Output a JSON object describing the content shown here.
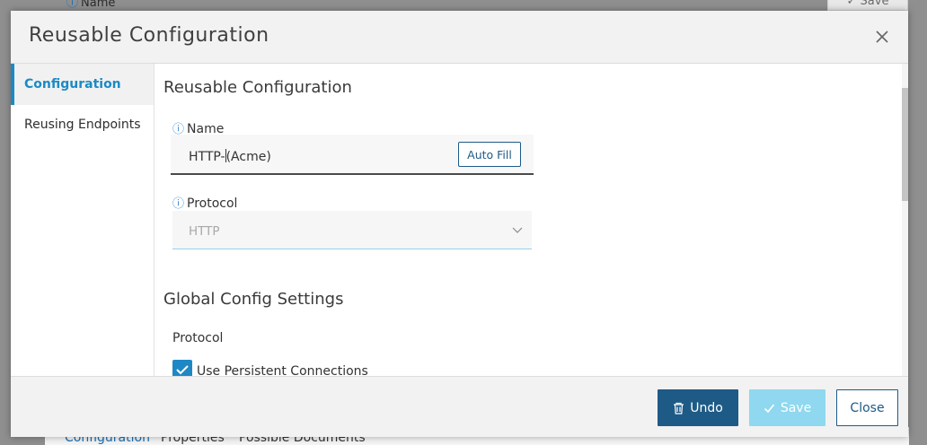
{
  "background": {
    "top_field_label": "Name",
    "top_save_label": "Save",
    "bottom_tabs": [
      "Configuration",
      "Properties",
      "Possible Documents"
    ]
  },
  "modal": {
    "title": "Reusable Configuration",
    "close_icon": "close-icon"
  },
  "sidebar": {
    "items": [
      {
        "label": "Configuration",
        "active": true
      },
      {
        "label": "Reusing Endpoints",
        "active": false
      }
    ]
  },
  "content": {
    "section_title": "Reusable Configuration",
    "name_field": {
      "label": "Name",
      "value_before_caret": "HTTP-",
      "value_after_caret": "(Acme)",
      "autofill_label": "Auto Fill"
    },
    "protocol_field": {
      "label": "Protocol",
      "value": "HTTP"
    },
    "global_title": "Global Config Settings",
    "global_protocol_label": "Protocol",
    "persistent_checkbox": {
      "label": "Use Persistent Connections",
      "checked": true
    }
  },
  "footer": {
    "undo_label": "Undo",
    "save_label": "Save",
    "close_label": "Close"
  },
  "colors": {
    "accent": "#1a8bc4",
    "primary_button": "#1e5a86",
    "disabled_button": "#8fd8ef"
  }
}
